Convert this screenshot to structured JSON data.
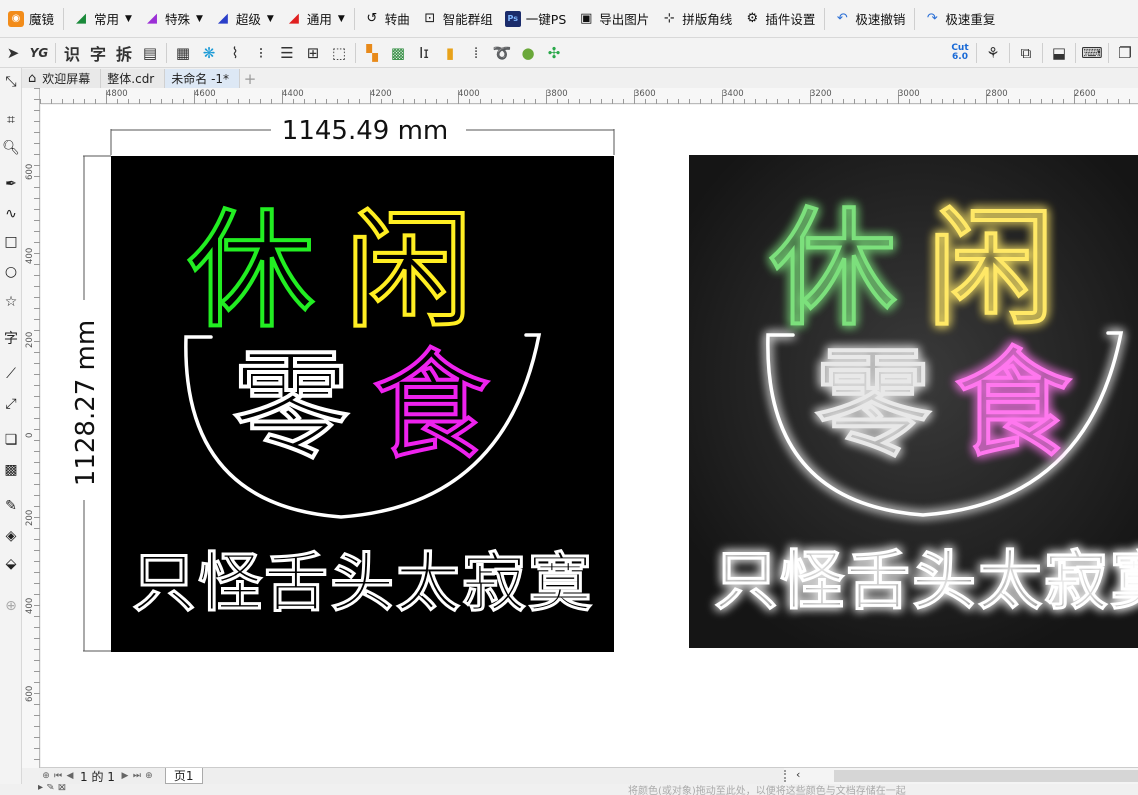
{
  "topbar": {
    "items": [
      {
        "label": "魔镜",
        "icon": "magic-mirror-icon",
        "caret": false
      },
      {
        "label": "常用",
        "icon": "common-arrow-icon",
        "caret": true
      },
      {
        "label": "特殊",
        "icon": "special-arrow-icon",
        "caret": true
      },
      {
        "label": "超级",
        "icon": "super-arrow-icon",
        "caret": true
      },
      {
        "label": "通用",
        "icon": "general-arrow-icon",
        "caret": true
      },
      {
        "label": "转曲",
        "icon": "curve-convert-icon",
        "caret": false
      },
      {
        "label": "智能群组",
        "icon": "smart-group-icon",
        "caret": false
      },
      {
        "label": "一键PS",
        "icon": "photoshop-icon",
        "caret": false
      },
      {
        "label": "导出图片",
        "icon": "export-image-icon",
        "caret": false
      },
      {
        "label": "拼版角线",
        "icon": "crop-marks-icon",
        "caret": false
      },
      {
        "label": "插件设置",
        "icon": "gear-icon",
        "caret": false
      },
      {
        "label": "极速撤销",
        "icon": "undo-icon",
        "caret": false
      },
      {
        "label": "极速重复",
        "icon": "redo-icon",
        "caret": false
      }
    ]
  },
  "toolbar2": {
    "text_tools": [
      "识",
      "字",
      "拆"
    ],
    "cut_badge": "6.0"
  },
  "tabs": [
    {
      "label": "欢迎屏幕",
      "home": true,
      "active": false
    },
    {
      "label": "整体.cdr",
      "home": false,
      "active": false
    },
    {
      "label": "未命名 -1*",
      "home": false,
      "active": true
    }
  ],
  "ruler": {
    "h_labels": [
      "4800",
      "4600",
      "4400",
      "4200",
      "4000",
      "3800",
      "3600",
      "3400",
      "3200",
      "3000",
      "2800",
      "2600"
    ],
    "v_labels": [
      "600",
      "400",
      "200",
      "0",
      "200",
      "400",
      "600"
    ]
  },
  "artwork": {
    "width_dim": "1145.49 mm",
    "height_dim": "1128.27 mm",
    "line1_left": "休",
    "line1_right": "闲",
    "line2_left": "零",
    "line2_right": "食",
    "slogan": "只怪舌头太寂寞",
    "colors": {
      "green": "#22ee22",
      "yellow": "#ffee22",
      "magenta": "#ee22ee",
      "white": "#ffffff",
      "board": "#000000"
    }
  },
  "pagebar": {
    "page_counter": "1 的 1",
    "page_tab": "页1"
  },
  "statusbar": {
    "hint": "将颜色(或对象)拖动至此处，以便将这些颜色与文档存储在一起"
  }
}
